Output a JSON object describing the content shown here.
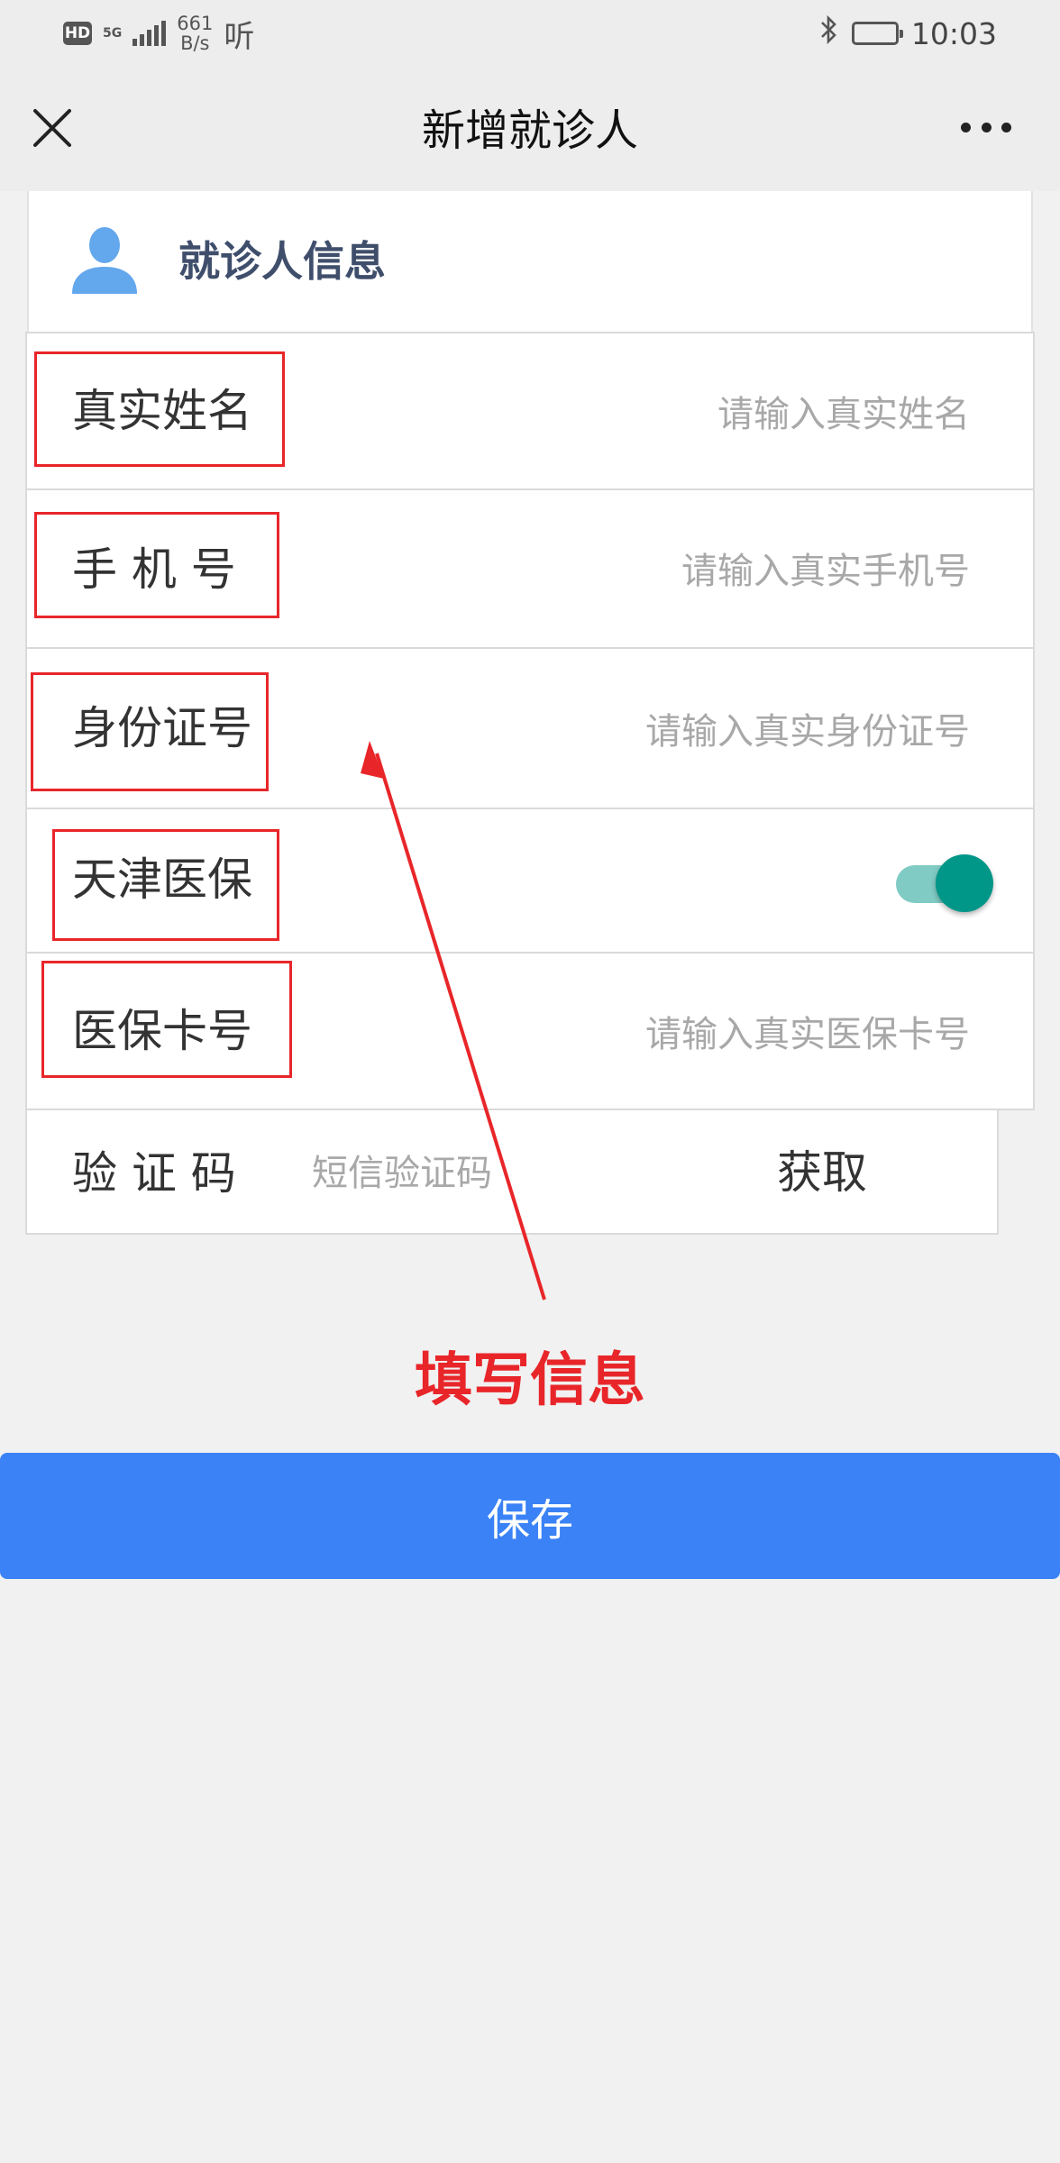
{
  "status_bar": {
    "hd": "HD",
    "network": "5G",
    "speed_value": "661",
    "speed_unit": "B/s",
    "listen": "听",
    "time": "10:03"
  },
  "nav": {
    "title": "新增就诊人"
  },
  "card": {
    "title": "就诊人信息"
  },
  "form": {
    "rows": [
      {
        "label": "真实姓名",
        "placeholder": "请输入真实姓名"
      },
      {
        "label": "手 机 号",
        "placeholder": "请输入真实手机号"
      },
      {
        "label": "身份证号",
        "placeholder": "请输入真实身份证号"
      },
      {
        "label": "天津医保",
        "toggle_on": true
      },
      {
        "label": "医保卡号",
        "placeholder": "请输入真实医保卡号"
      }
    ],
    "verify": {
      "label": "验 证 码",
      "placeholder": "短信验证码",
      "button": "获取"
    }
  },
  "annotation": {
    "text": "填写信息",
    "color": "#e8262a"
  },
  "save_button": "保存",
  "colors": {
    "primary": "#3a82f6",
    "toggle": "#009688",
    "title_text": "#3f4e6b"
  }
}
